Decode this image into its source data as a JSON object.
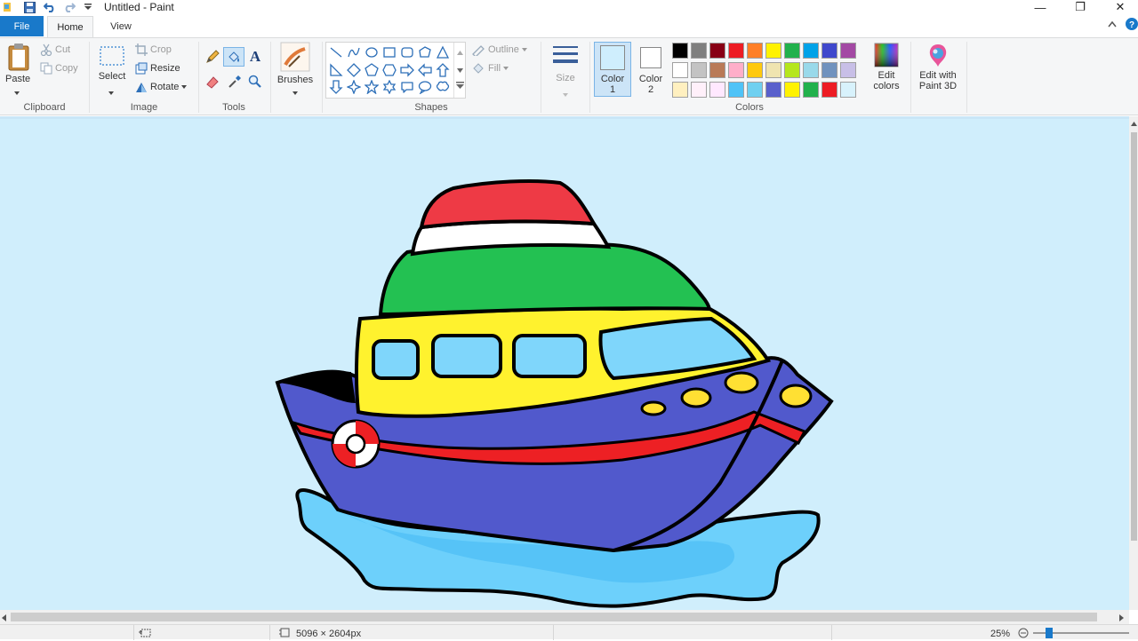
{
  "window": {
    "title": "Untitled - Paint",
    "controls": {
      "minimize": "—",
      "restore": "❐",
      "close": "✕"
    }
  },
  "tabs": {
    "file": "File",
    "home": "Home",
    "view": "View"
  },
  "ribbon": {
    "clipboard": {
      "label": "Clipboard",
      "paste": "Paste",
      "cut": "Cut",
      "copy": "Copy"
    },
    "image": {
      "label": "Image",
      "select": "Select",
      "crop": "Crop",
      "resize": "Resize",
      "rotate": "Rotate"
    },
    "tools": {
      "label": "Tools"
    },
    "brushes": {
      "label": "Brushes"
    },
    "shapes": {
      "label": "Shapes",
      "outline": "Outline",
      "fill": "Fill"
    },
    "size": {
      "label": "Size"
    },
    "colors": {
      "label": "Colors",
      "color1_label_a": "Color",
      "color1_label_b": "1",
      "color2_label_a": "Color",
      "color2_label_b": "2",
      "edit_colors_a": "Edit",
      "edit_colors_b": "colors",
      "paint3d_a": "Edit with",
      "paint3d_b": "Paint 3D",
      "color1_value": "#cfeefd",
      "color2_value": "#ffffff",
      "palette_row1": [
        "#000000",
        "#7f7f7f",
        "#880015",
        "#ed1c24",
        "#ff7f27",
        "#fff200",
        "#22b14c",
        "#00a2e8",
        "#3f48cc",
        "#a349a4"
      ],
      "palette_row2": [
        "#ffffff",
        "#c3c3c3",
        "#b97a57",
        "#ffaec9",
        "#ffc90e",
        "#efe4b0",
        "#b5e61d",
        "#99d9ea",
        "#7092be",
        "#c8bfe7"
      ],
      "palette_row3": [
        "#fff0c0",
        "#fff0fa",
        "#ffe8ff",
        "#4fc3f7",
        "#6fd0f0",
        "#5960cc",
        "#fff200",
        "#22b14c",
        "#ed1c24",
        "#d8f2fc"
      ]
    }
  },
  "status": {
    "dimensions": "5096 × 2604px",
    "zoom": "25%"
  }
}
